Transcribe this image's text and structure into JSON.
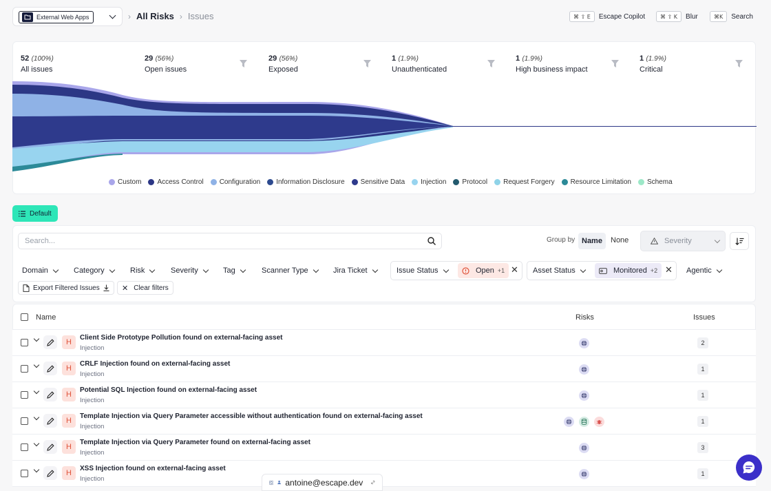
{
  "header": {
    "project": "External Web Apps",
    "breadcrumb": [
      "All Risks",
      "Issues"
    ],
    "shortcuts": [
      {
        "keys": "⌘ ⇧ E",
        "label": "Escape Copilot"
      },
      {
        "keys": "⌘ ⇧ K",
        "label": "Blur"
      },
      {
        "keys": "⌘K",
        "label": "Search"
      }
    ]
  },
  "funnel": {
    "stats": [
      {
        "count": "52",
        "pct": "(100%)",
        "label": "All issues"
      },
      {
        "count": "29",
        "pct": "(56%)",
        "label": "Open issues"
      },
      {
        "count": "29",
        "pct": "(56%)",
        "label": "Exposed"
      },
      {
        "count": "1",
        "pct": "(1.9%)",
        "label": "Unauthenticated"
      },
      {
        "count": "1",
        "pct": "(1.9%)",
        "label": "High business impact"
      },
      {
        "count": "1",
        "pct": "(1.9%)",
        "label": "Critical"
      }
    ],
    "legend": [
      {
        "name": "Custom",
        "color": "#a9a6ea"
      },
      {
        "name": "Access Control",
        "color": "#2c3785"
      },
      {
        "name": "Configuration",
        "color": "#8fb2e6"
      },
      {
        "name": "Information Disclosure",
        "color": "#2d4a8f"
      },
      {
        "name": "Sensitive Data",
        "color": "#2e3a8c"
      },
      {
        "name": "Injection",
        "color": "#98d4ef"
      },
      {
        "name": "Protocol",
        "color": "#235a6e"
      },
      {
        "name": "Request Forgery",
        "color": "#8fd3e8"
      },
      {
        "name": "Resource Limitation",
        "color": "#2c8a98"
      },
      {
        "name": "Schema",
        "color": "#9de8c8"
      }
    ]
  },
  "view": {
    "default_label": "Default"
  },
  "toolbar": {
    "search_placeholder": "Search...",
    "group_by_label": "Group by",
    "group_by_name": "Name",
    "group_by_none": "None",
    "severity_placeholder": "Severity"
  },
  "filters": {
    "domain": "Domain",
    "category": "Category",
    "risk": "Risk",
    "severity": "Severity",
    "tag": "Tag",
    "scanner_type": "Scanner Type",
    "jira_ticket": "Jira Ticket",
    "issue_status": "Issue Status",
    "issue_status_value": "Open",
    "issue_status_more": "+1",
    "asset_status": "Asset Status",
    "asset_status_value": "Monitored",
    "asset_status_more": "+2",
    "agentic": "Agentic",
    "export_label": "Export Filtered Issues",
    "clear_label": "Clear filters"
  },
  "table": {
    "columns": {
      "name": "Name",
      "risks": "Risks",
      "issues": "Issues"
    },
    "rows": [
      {
        "title": "Client Side Prototype Pollution found on external-facing asset",
        "category": "Injection",
        "severity": "H",
        "issues": "2",
        "risks": [
          "globe-icon"
        ]
      },
      {
        "title": "CRLF Injection found on external-facing asset",
        "category": "Injection",
        "severity": "H",
        "issues": "1",
        "risks": [
          "globe-icon"
        ]
      },
      {
        "title": "Potential SQL Injection found on external-facing asset",
        "category": "Injection",
        "severity": "H",
        "issues": "1",
        "risks": [
          "globe-icon"
        ]
      },
      {
        "title": "Template Injection via Query Parameter accessible without authentication found on external-facing asset",
        "category": "Injection",
        "severity": "H",
        "issues": "1",
        "risks": [
          "globe-icon",
          "database-icon",
          "bug-icon"
        ]
      },
      {
        "title": "Template Injection via Query Parameter found on external-facing asset",
        "category": "Injection",
        "severity": "H",
        "issues": "3",
        "risks": [
          "globe-icon"
        ]
      },
      {
        "title": "XSS Injection found on external-facing asset",
        "category": "Injection",
        "severity": "H",
        "issues": "1",
        "risks": [
          "globe-icon"
        ]
      }
    ]
  },
  "footer": {
    "user": "antoine@escape.dev"
  }
}
